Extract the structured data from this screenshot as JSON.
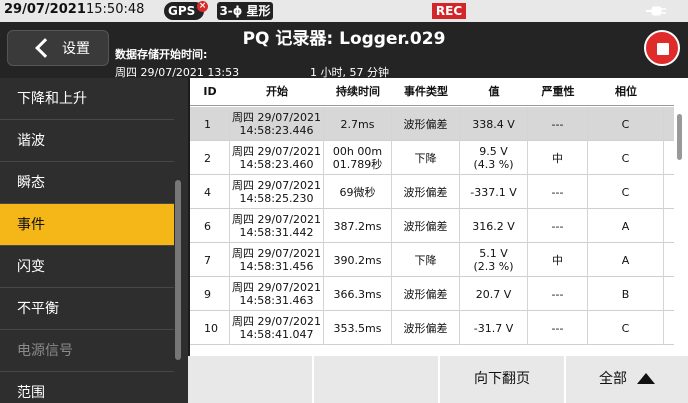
{
  "status": {
    "date": "29/07/2021",
    "time": "15:50:48",
    "gps": "GPS",
    "gps_error": "×",
    "phase": "3-ϕ 星形",
    "rec": "REC"
  },
  "header": {
    "back_label": "设置",
    "title": "PQ 记录器: Logger.029",
    "start_label": "数据存储开始时间:",
    "start_value": "周四 29/07/2021 13:53",
    "duration_value": "1 小时, 57 分钟"
  },
  "sidebar": {
    "items": [
      {
        "label": "下降和上升"
      },
      {
        "label": "谐波"
      },
      {
        "label": "瞬态"
      },
      {
        "label": "事件"
      },
      {
        "label": "闪变"
      },
      {
        "label": "不平衡"
      },
      {
        "label": "电源信号"
      },
      {
        "label": "范围"
      }
    ]
  },
  "table": {
    "headers": [
      "ID",
      "开始",
      "持续时间",
      "事件类型",
      "值",
      "严重性",
      "相位"
    ],
    "rows": [
      {
        "id": "1",
        "start1": "周四 29/07/2021",
        "start2": "14:58:23.446",
        "dur1": "2.7ms",
        "dur2": "",
        "type": "波形偏差",
        "val1": "338.4 V",
        "val2": "",
        "sev": "---",
        "phase": "C"
      },
      {
        "id": "2",
        "start1": "周四 29/07/2021",
        "start2": "14:58:23.460",
        "dur1": "00h 00m",
        "dur2": "01.789秒",
        "type": "下降",
        "val1": "9.5 V",
        "val2": "(4.3 %)",
        "sev": "中",
        "phase": "C"
      },
      {
        "id": "4",
        "start1": "周四 29/07/2021",
        "start2": "14:58:25.230",
        "dur1": "69微秒",
        "dur2": "",
        "type": "波形偏差",
        "val1": "-337.1 V",
        "val2": "",
        "sev": "---",
        "phase": "C"
      },
      {
        "id": "6",
        "start1": "周四 29/07/2021",
        "start2": "14:58:31.442",
        "dur1": "387.2ms",
        "dur2": "",
        "type": "波形偏差",
        "val1": "316.2 V",
        "val2": "",
        "sev": "---",
        "phase": "A"
      },
      {
        "id": "7",
        "start1": "周四 29/07/2021",
        "start2": "14:58:31.456",
        "dur1": "390.2ms",
        "dur2": "",
        "type": "下降",
        "val1": "5.1 V",
        "val2": "(2.3 %)",
        "sev": "中",
        "phase": "A"
      },
      {
        "id": "9",
        "start1": "周四 29/07/2021",
        "start2": "14:58:31.463",
        "dur1": "366.3ms",
        "dur2": "",
        "type": "波形偏差",
        "val1": "20.7 V",
        "val2": "",
        "sev": "---",
        "phase": "B"
      },
      {
        "id": "10",
        "start1": "周四 29/07/2021",
        "start2": "14:58:41.047",
        "dur1": "353.5ms",
        "dur2": "",
        "type": "波形偏差",
        "val1": "-31.7 V",
        "val2": "",
        "sev": "---",
        "phase": "C"
      }
    ]
  },
  "bottom": {
    "page_down": "向下翻页",
    "all": "全部"
  },
  "colors": {
    "accent": "#f5b718",
    "rec": "#d3262a",
    "stop": "#e02b2b"
  }
}
